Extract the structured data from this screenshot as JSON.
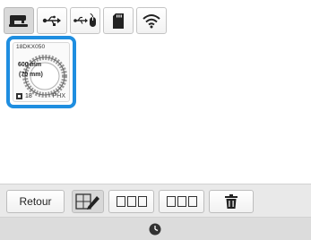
{
  "tabs": [
    {
      "icon": "sewing-machine-icon",
      "active": true
    },
    {
      "icon": "usb-icon",
      "active": false
    },
    {
      "icon": "usb-mouse-icon",
      "active": false
    },
    {
      "icon": "sd-card-icon",
      "active": false
    },
    {
      "icon": "wifi-icon",
      "active": false
    }
  ],
  "pattern": {
    "code": "18DKX050",
    "width": "600 mm",
    "height": "(70 mm)",
    "color_count": "18",
    "source": "PHX",
    "selected": true
  },
  "toolbar": {
    "back_label": "Retour",
    "edit_icon": "edit-pattern-icon",
    "select_icons": [
      "select-all-icon",
      "deselect-all-icon"
    ],
    "delete_icon": "trash-icon"
  },
  "status": {
    "icon": "clock-icon"
  },
  "colors": {
    "accent": "#1f8ee0",
    "toolbar_bg": "#e9e9e9",
    "status_bg": "#dcdcdc"
  }
}
